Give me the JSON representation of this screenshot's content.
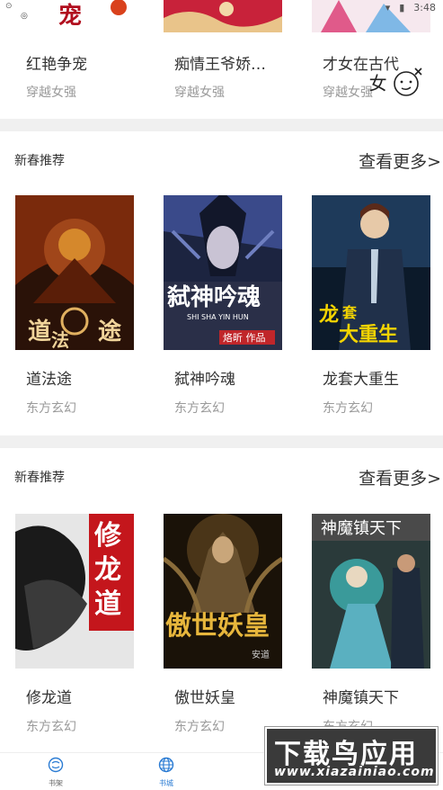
{
  "status_bar": {
    "time": "3:48"
  },
  "top_row": {
    "books": [
      {
        "title": "红艳争宠",
        "genre": "穿越女强"
      },
      {
        "title": "痴情王爷娇…",
        "genre": "穿越女强"
      },
      {
        "title": "才女在古代",
        "genre": "穿越女强"
      }
    ]
  },
  "overlay_badge": {
    "text": "女"
  },
  "sections": [
    {
      "title": "新春推荐",
      "more_label": "查看更多>",
      "books": [
        {
          "title": "道法途",
          "genre": "东方玄幻",
          "cover_text": "道 法"
        },
        {
          "title": "弑神吟魂",
          "genre": "东方玄幻",
          "cover_text": "弑神吟魂",
          "cover_sub": "SHI SHA YIN HUN",
          "cover_author": "烙昕 作品"
        },
        {
          "title": "龙套大重生",
          "genre": "东方玄幻",
          "cover_text": "龙套大重生"
        }
      ]
    },
    {
      "title": "新春推荐",
      "more_label": "查看更多>",
      "books": [
        {
          "title": "修龙道",
          "genre": "东方玄幻",
          "cover_text": "修龙道"
        },
        {
          "title": "傲世妖皇",
          "genre": "东方玄幻",
          "cover_text": "傲世妖皇",
          "cover_author": "安道"
        },
        {
          "title": "神魔镇天下",
          "genre": "东方玄幻",
          "cover_text": "神魔镇天下"
        }
      ]
    }
  ],
  "tabbar": {
    "tabs": [
      {
        "label": "书架"
      },
      {
        "label": "书城"
      }
    ]
  },
  "watermark": {
    "big": "下载鸟应用",
    "small": "www.xiazainiao.com"
  },
  "colors": {
    "accent": "#2a7bd3",
    "divider": "#f0f0f0",
    "genre_text": "#9a9a9a"
  }
}
